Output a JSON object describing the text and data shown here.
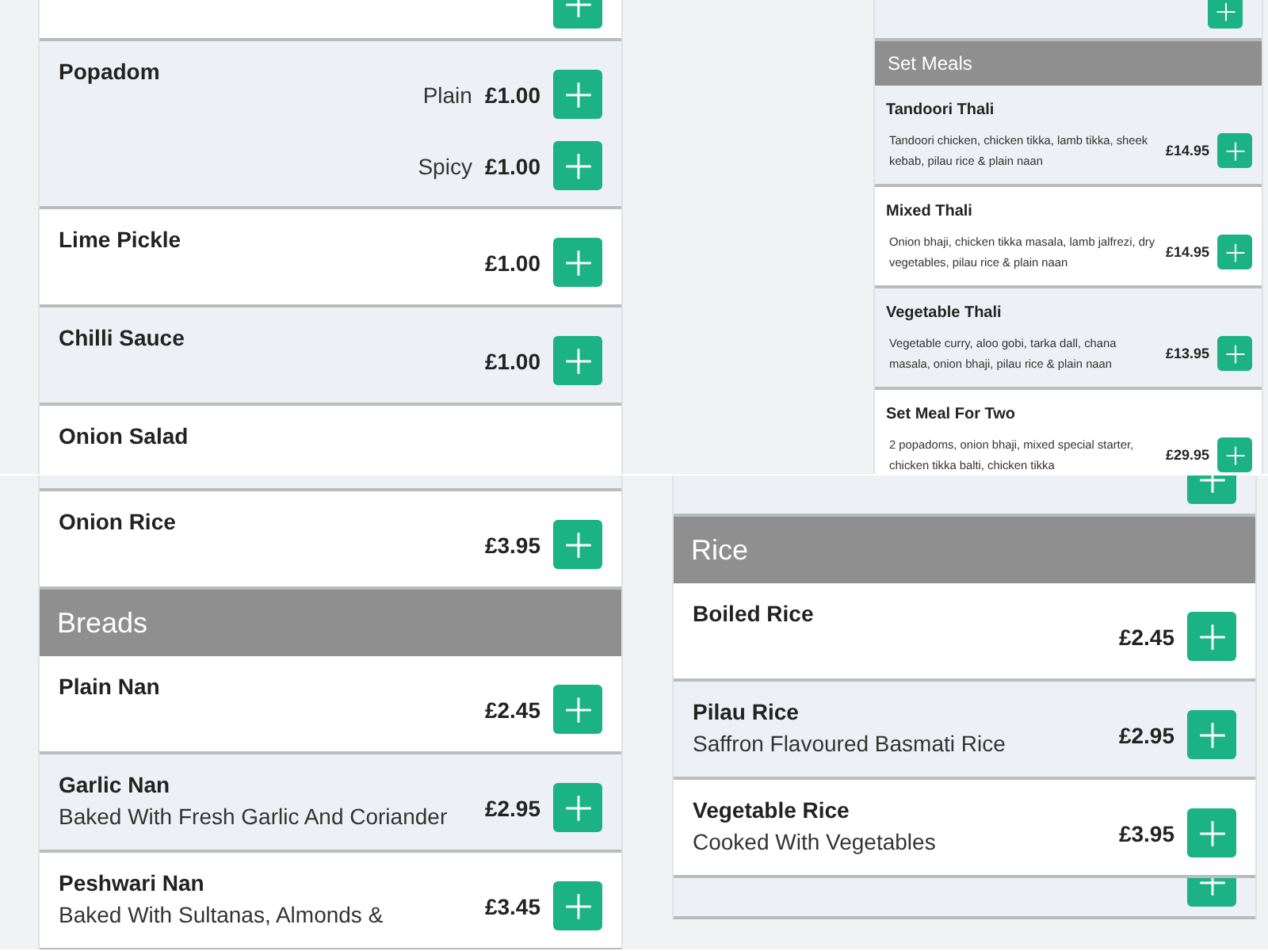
{
  "panels": [
    {
      "kind": "regular",
      "rows": [
        {
          "kind": "stub",
          "shaded": false
        },
        {
          "kind": "item",
          "shaded": true,
          "name": "Popadom",
          "options": [
            {
              "label": "Plain",
              "price": "£1.00"
            },
            {
              "label": "Spicy",
              "price": "£1.00"
            }
          ]
        },
        {
          "kind": "item",
          "shaded": false,
          "name": "Lime Pickle",
          "options": [
            {
              "price": "£1.00"
            }
          ]
        },
        {
          "kind": "item",
          "shaded": true,
          "name": "Chilli Sauce",
          "options": [
            {
              "price": "£1.00"
            }
          ]
        },
        {
          "kind": "item",
          "shaded": false,
          "name": "Onion Salad",
          "options": []
        }
      ]
    },
    {
      "kind": "compact",
      "rows": [
        {
          "kind": "stub",
          "shaded": true
        },
        {
          "kind": "header",
          "title": "Set Meals"
        },
        {
          "kind": "item",
          "shaded": true,
          "name": "Tandoori Thali",
          "description": "Tandoori chicken, chicken tikka, lamb tikka, sheek kebab, pilau rice & plain naan",
          "options": [
            {
              "price": "£14.95"
            }
          ]
        },
        {
          "kind": "item",
          "shaded": false,
          "name": "Mixed Thali",
          "description": "Onion bhaji, chicken tikka masala, lamb jalfrezi, dry vegetables, pilau rice & plain naan",
          "options": [
            {
              "price": "£14.95"
            }
          ]
        },
        {
          "kind": "item",
          "shaded": true,
          "name": "Vegetable Thali",
          "description": "Vegetable curry, aloo gobi, tarka dall, chana masala, onion bhaji, pilau rice & plain naan",
          "options": [
            {
              "price": "£13.95"
            }
          ]
        },
        {
          "kind": "item",
          "shaded": false,
          "name": "Set Meal For Two",
          "description": "2 popadoms, onion bhaji, mixed special starter, chicken tikka balti, chicken tikka",
          "options": [
            {
              "price": "£29.95"
            }
          ]
        }
      ]
    },
    {
      "kind": "regular",
      "rows": [
        {
          "kind": "edge",
          "shaded": true
        },
        {
          "kind": "item",
          "shaded": false,
          "name": "Onion Rice",
          "options": [
            {
              "price": "£3.95"
            }
          ]
        },
        {
          "kind": "header",
          "title": "Breads"
        },
        {
          "kind": "item",
          "shaded": false,
          "name": "Plain Nan",
          "options": [
            {
              "price": "£2.45"
            }
          ]
        },
        {
          "kind": "item",
          "shaded": true,
          "name": "Garlic Nan",
          "description": "Baked With Fresh Garlic And Coriander",
          "options": [
            {
              "price": "£2.95"
            }
          ]
        },
        {
          "kind": "item",
          "shaded": false,
          "name": "Peshwari Nan",
          "description": "Baked With Sultanas, Almonds &",
          "options": [
            {
              "price": "£3.45"
            }
          ]
        }
      ]
    },
    {
      "kind": "regular",
      "rows": [
        {
          "kind": "stub",
          "shaded": true
        },
        {
          "kind": "header",
          "title": "Rice"
        },
        {
          "kind": "item",
          "shaded": false,
          "name": "Boiled Rice",
          "options": [
            {
              "price": "£2.45"
            }
          ]
        },
        {
          "kind": "item",
          "shaded": true,
          "name": "Pilau Rice",
          "description": "Saffron Flavoured Basmati Rice",
          "options": [
            {
              "price": "£2.95"
            }
          ]
        },
        {
          "kind": "item",
          "shaded": false,
          "name": "Vegetable Rice",
          "description": "Cooked With Vegetables",
          "options": [
            {
              "price": "£3.95"
            }
          ]
        },
        {
          "kind": "stub",
          "shaded": true
        }
      ]
    }
  ]
}
